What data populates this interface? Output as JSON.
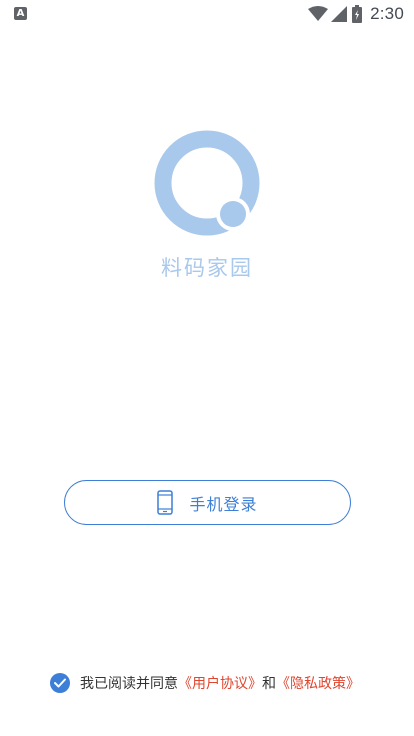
{
  "status_bar": {
    "left_icon_letter": "A",
    "time": "2:30"
  },
  "app": {
    "name": "料码家园"
  },
  "login": {
    "phone_login_label": "手机登录"
  },
  "agreement": {
    "checked": true,
    "prefix": "我已阅读并同意",
    "user_agreement": "《用户协议》",
    "and": "和",
    "privacy_policy": "《隐私政策》"
  },
  "colors": {
    "accent": "#3d7ed6",
    "logo": "#a8c8ec",
    "link": "#e0452f"
  }
}
